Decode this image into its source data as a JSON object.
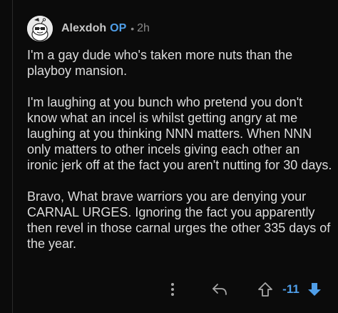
{
  "comment": {
    "username": "Alexdoh",
    "op_badge": "OP",
    "separator": "•",
    "age": "2h",
    "avatar_icon": "snoo-avatar-icon",
    "paragraphs": [
      "I'm a gay dude who's taken more nuts than the playboy mansion.",
      "I'm laughing at you bunch who pretend you don't know what an incel is whilst getting angry at me laughing at you thinking NNN matters. When NNN only matters to other incels giving each other an ironic jerk off at the fact you aren't nutting for 30 days.",
      "Bravo, What brave warriors you are denying your CARNAL URGES. Ignoring the fact you apparently then revel in those carnal urges the other 335 days of the year."
    ]
  },
  "actions": {
    "more_icon": "more-vertical-icon",
    "reply_icon": "reply-arrow-icon",
    "upvote_icon": "upvote-arrow-icon",
    "score": "-11",
    "downvote_icon": "downvote-arrow-icon",
    "accent_color": "#4f9ee8"
  }
}
